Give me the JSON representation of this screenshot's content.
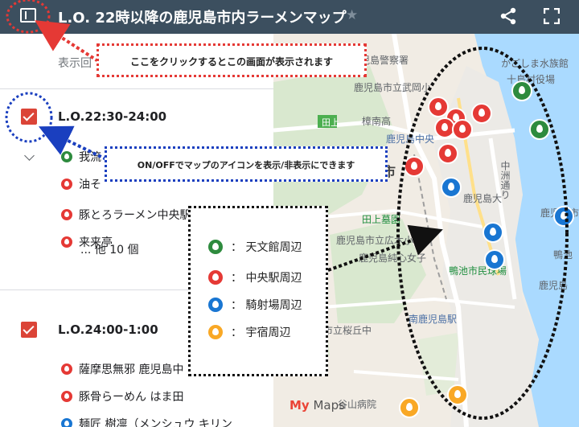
{
  "header": {
    "title": "L.O. 22時以降の鹿児島市内ラーメンマップ"
  },
  "panel": {
    "subtext": "表示回",
    "layers": [
      {
        "title": "L.O.22:30-24:00",
        "items": [
          {
            "label": "我流",
            "color": "#2e8b3e"
          },
          {
            "label": "油そ",
            "color": "#e53935"
          },
          {
            "label": "豚とろラーメン中央駅前店",
            "color": "#e53935"
          },
          {
            "label": "来来亭",
            "color": "#e53935"
          }
        ],
        "more": "... 他 10 個"
      },
      {
        "title": "L.O.24:00-1:00",
        "items": [
          {
            "label": "薩摩思無邪 鹿児島中",
            "color": "#e53935"
          },
          {
            "label": "豚骨らーめん はま田",
            "color": "#e53935"
          },
          {
            "label": "麺匠 樹凛（メンシュウ キリン",
            "color": "#1976d2"
          }
        ]
      }
    ]
  },
  "map": {
    "labels": [
      {
        "text": "鹿児島警察署"
      },
      {
        "text": "かごしま水族館"
      },
      {
        "text": "十島村役場"
      },
      {
        "text": "鹿児島市立武岡小"
      },
      {
        "text": "田上"
      },
      {
        "text": "樟南高"
      },
      {
        "text": "鹿児島中央"
      },
      {
        "text": "島市"
      },
      {
        "text": "鹿児島大"
      },
      {
        "text": "田上墓園"
      },
      {
        "text": "鹿児島市立広木小"
      },
      {
        "text": "鹿児島純心女子"
      },
      {
        "text": "鴨池市民球場"
      },
      {
        "text": "鹿児島"
      },
      {
        "text": "市立桜丘中"
      },
      {
        "text": "南鹿児島駅"
      },
      {
        "text": "谷山病院"
      },
      {
        "text": "中洲通り"
      },
      {
        "text": "鹿児島市"
      },
      {
        "text": "鴨池"
      }
    ],
    "footer_prefix": "My",
    "footer_suffix": " Maps"
  },
  "annotations": {
    "red_box": "ここをクリックするとこの画面が表示されます",
    "blue_box": "ON/OFFでマップのアイコンを表示/非表示にできます"
  },
  "legend": {
    "items": [
      {
        "label": "： 天文館周辺",
        "color": "#2e8b3e"
      },
      {
        "label": "： 中央駅周辺",
        "color": "#e53935"
      },
      {
        "label": "： 騎射場周辺",
        "color": "#1976d2"
      },
      {
        "label": "： 宇宿周辺",
        "color": "#f9a825"
      }
    ]
  },
  "colors": {
    "header_bg": "#3c4f5f",
    "checkbox": "#db4437",
    "annotation_red": "#e53935",
    "annotation_blue": "#1a3fbf"
  }
}
